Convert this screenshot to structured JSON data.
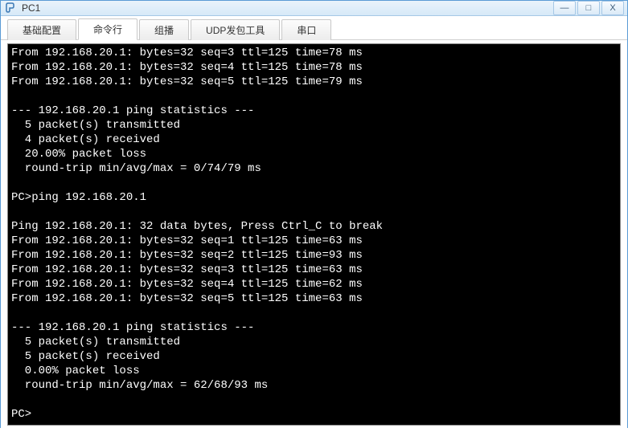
{
  "window": {
    "title": "PC1",
    "controls": {
      "min": "—",
      "max": "□",
      "close": "X"
    }
  },
  "tabs": [
    {
      "label": "基础配置",
      "active": false
    },
    {
      "label": "命令行",
      "active": true
    },
    {
      "label": "组播",
      "active": false
    },
    {
      "label": "UDP发包工具",
      "active": false
    },
    {
      "label": "串口",
      "active": false
    }
  ],
  "terminal_lines": [
    "From 192.168.20.1: bytes=32 seq=3 ttl=125 time=78 ms",
    "From 192.168.20.1: bytes=32 seq=4 ttl=125 time=78 ms",
    "From 192.168.20.1: bytes=32 seq=5 ttl=125 time=79 ms",
    "",
    "--- 192.168.20.1 ping statistics ---",
    "  5 packet(s) transmitted",
    "  4 packet(s) received",
    "  20.00% packet loss",
    "  round-trip min/avg/max = 0/74/79 ms",
    "",
    "PC>ping 192.168.20.1",
    "",
    "Ping 192.168.20.1: 32 data bytes, Press Ctrl_C to break",
    "From 192.168.20.1: bytes=32 seq=1 ttl=125 time=63 ms",
    "From 192.168.20.1: bytes=32 seq=2 ttl=125 time=93 ms",
    "From 192.168.20.1: bytes=32 seq=3 ttl=125 time=63 ms",
    "From 192.168.20.1: bytes=32 seq=4 ttl=125 time=62 ms",
    "From 192.168.20.1: bytes=32 seq=5 ttl=125 time=63 ms",
    "",
    "--- 192.168.20.1 ping statistics ---",
    "  5 packet(s) transmitted",
    "  5 packet(s) received",
    "  0.00% packet loss",
    "  round-trip min/avg/max = 62/68/93 ms",
    "",
    "PC>"
  ]
}
